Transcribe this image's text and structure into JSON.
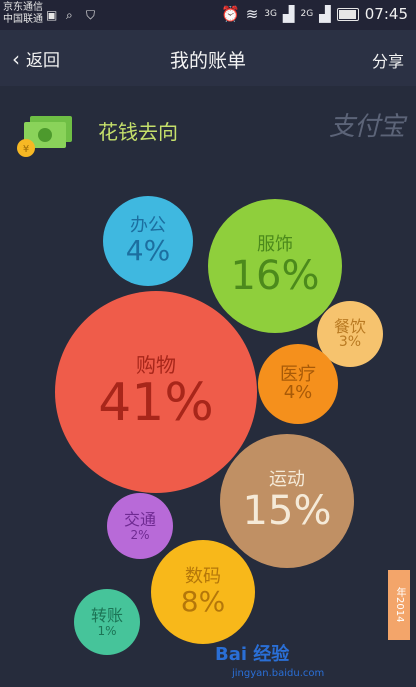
{
  "status": {
    "carrier1": "京东通信",
    "carrier2": "中国联通",
    "net3g": "3G",
    "net2g": "2G",
    "time": "07:45"
  },
  "nav": {
    "back": "返回",
    "title": "我的账单",
    "share": "分享"
  },
  "section": {
    "title": "花钱去向",
    "watermark": "支付宝"
  },
  "bubbles": [
    {
      "label": "办公",
      "percent": "4%",
      "color": "#3fb8e0",
      "text_color": "#1c6fa0"
    },
    {
      "label": "服饰",
      "percent": "16%",
      "color": "#8fcf3c",
      "text_color": "#4c8a1c"
    },
    {
      "label": "餐饮",
      "percent": "3%",
      "color": "#f6c36e",
      "text_color": "#b97a22"
    },
    {
      "label": "购物",
      "percent": "41%",
      "color": "#ef5c4a",
      "text_color": "#a8261a"
    },
    {
      "label": "医疗",
      "percent": "4%",
      "color": "#f5901c",
      "text_color": "#a85a08"
    },
    {
      "label": "运动",
      "percent": "15%",
      "color": "#c09064",
      "text_color": "#f5ead8"
    },
    {
      "label": "交通",
      "percent": "2%",
      "color": "#b86ad8",
      "text_color": "#6f2a92"
    },
    {
      "label": "数码",
      "percent": "8%",
      "color": "#f8b81a",
      "text_color": "#b4770a"
    },
    {
      "label": "转账",
      "percent": "1%",
      "color": "#46c49a",
      "text_color": "#1c7556"
    }
  ],
  "ribbon": "年2014",
  "overlay": {
    "baidu": "Bai 经验",
    "baidu_sub": "jingyan.baidu.com"
  }
}
